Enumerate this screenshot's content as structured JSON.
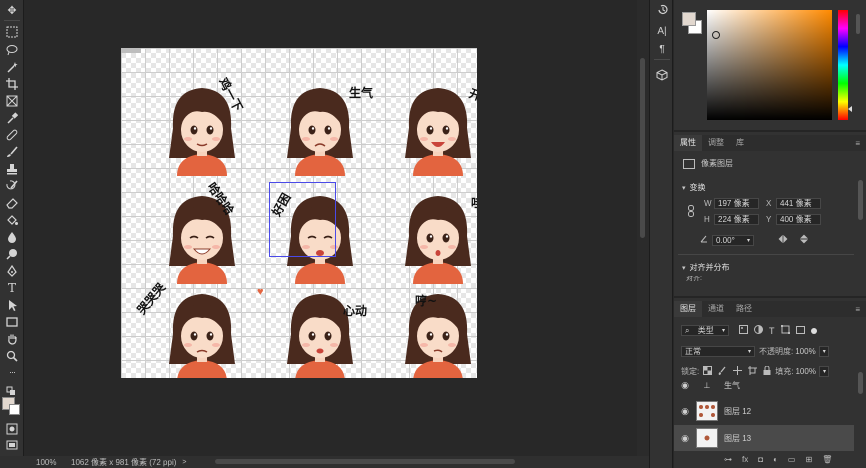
{
  "toolbar": {
    "tools": [
      "move-icon",
      "marquee-icon",
      "lasso-icon",
      "magic-wand-icon",
      "crop-icon",
      "frame-icon",
      "eyedropper-icon",
      "healing-brush-icon",
      "brush-icon",
      "stamp-icon",
      "history-brush-icon",
      "eraser-icon",
      "paint-bucket-icon",
      "blur-icon",
      "dodge-icon",
      "pen-icon",
      "type-icon",
      "path-select-icon",
      "rectangle-icon",
      "hand-icon",
      "zoom-icon",
      "more-icon"
    ],
    "type_glyph": "T"
  },
  "canvas": {
    "stickers": [
      {
        "caption": "鸡一下"
      },
      {
        "caption": "生气"
      },
      {
        "caption": "开心"
      },
      {
        "caption": "哈哈哈"
      },
      {
        "caption": "好困"
      },
      {
        "caption": "哇?"
      },
      {
        "caption": "哭哭哭"
      },
      {
        "caption": "心动"
      },
      {
        "caption": "哼~"
      }
    ]
  },
  "statusbar": {
    "zoom": "100%",
    "doc_info": "1062 像素 x 981 像素 (72 ppi)",
    "arrow": ">"
  },
  "midstrip": {
    "icons": [
      "history-icon",
      "char-icon",
      "paragraph-icon",
      "3d-icon"
    ],
    "char_glyph": "A|",
    "para_glyph": "¶"
  },
  "color": {
    "foreground": "#e2d8cf",
    "background": "#ffffff",
    "hue_accent": "#ff8a00"
  },
  "properties": {
    "tabs": [
      "属性",
      "调整",
      "库"
    ],
    "layer_kind": "像素图层",
    "transform_title": "变换",
    "w_label": "W",
    "w_value": "197 像素",
    "x_label": "X",
    "x_value": "441 像素",
    "h_label": "H",
    "h_value": "224 像素",
    "y_label": "Y",
    "y_value": "400 像素",
    "angle_value": "0.00°",
    "align_title": "对齐并分布",
    "align_sub": "对齐:"
  },
  "layers": {
    "tabs": [
      "图层",
      "通道",
      "路径"
    ],
    "filter_kind": "类型",
    "blend_mode": "正常",
    "opacity_label": "不透明度:",
    "opacity_value": "100%",
    "lock_label": "锁定:",
    "fill_label": "填充:",
    "fill_value": "100%",
    "items": [
      {
        "name": "生气",
        "type": "text"
      },
      {
        "name": "图层 12",
        "type": "pixel"
      },
      {
        "name": "图层 13",
        "type": "pixel"
      }
    ]
  }
}
